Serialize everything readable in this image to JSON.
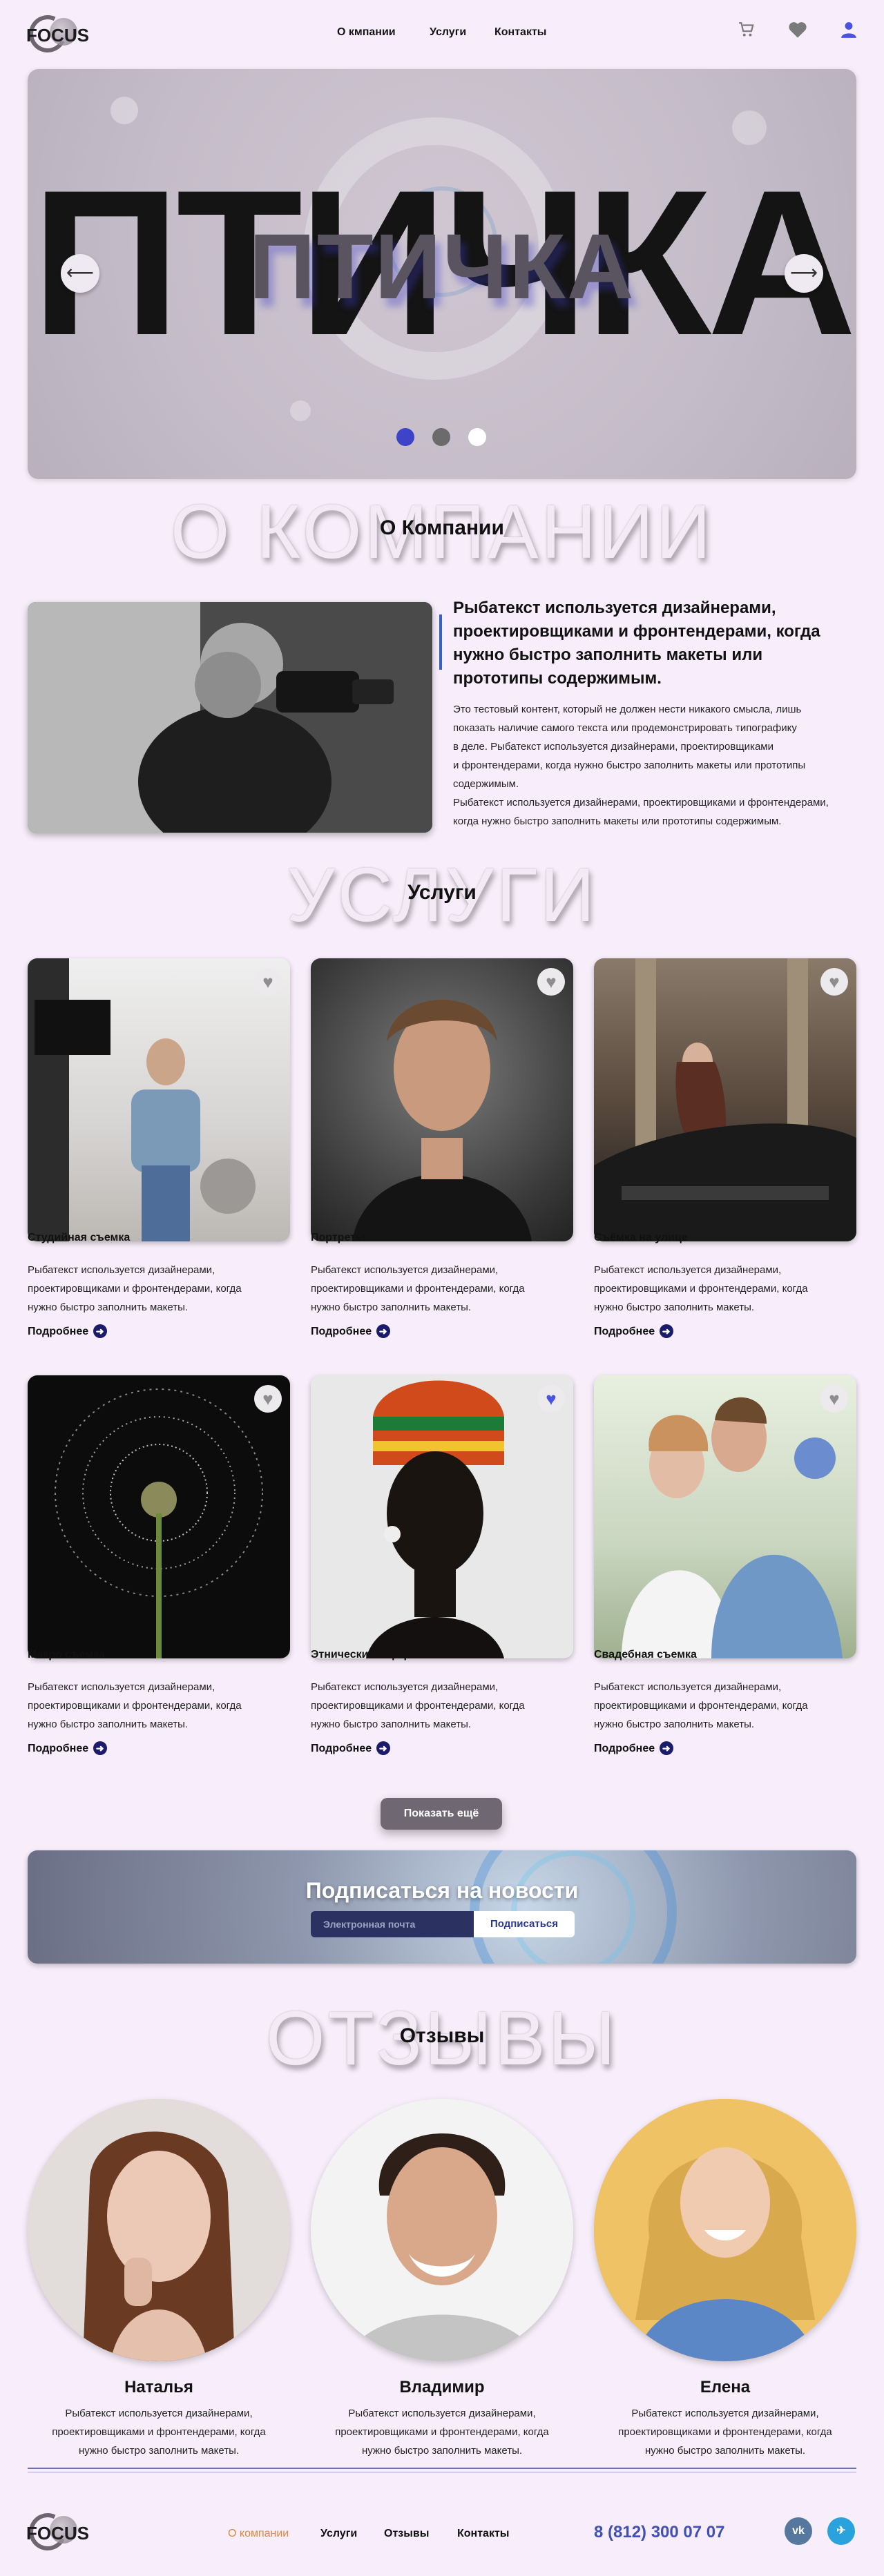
{
  "brand": {
    "name": "FOCUS"
  },
  "header": {
    "nav": [
      "О кмпании",
      "Услуги",
      "Контакты"
    ],
    "icons": [
      "cart-icon",
      "heart-icon",
      "user-icon"
    ],
    "accent": "#4a52e0"
  },
  "hero": {
    "big_text": "ПТИЧКА",
    "small_text": "ПТИЧКА",
    "prev": "⟵",
    "next": "⟶",
    "dots": [
      "#3d44c8",
      "#6b6b6b",
      "#ffffff"
    ]
  },
  "about": {
    "bg_title": "О КОМПАНИИ",
    "title": "О Компании",
    "heading": "Рыбатекст используется дизайнерами, проектировщиками и фронтендерами, когда нужно быстро заполнить макеты или прототипы содержимым.",
    "text": [
      "Это тестовый контент, который не должен нести никакого смысла, лишь",
      "показать наличие самого текста или продемонстрировать типографику",
      "в деле. Рыбатекст используется дизайнерами, проектировщиками",
      "и фронтендерами, когда нужно быстро заполнить макеты или прототипы",
      "содержимым.",
      "Рыбатекст используется дизайнерами, проектировщиками и фронтендерами,",
      "когда нужно быстро заполнить макеты или прототипы содержимым."
    ]
  },
  "services": {
    "bg_title": "УСЛУГИ",
    "title": "Услуги",
    "more_label": "Подробнее",
    "items": [
      {
        "title": "Студийная съемка",
        "desc": [
          "Рыбатекст используется дизайнерами,",
          "проектировщиками и фронтендерами, когда",
          "нужно быстро заполнить макеты."
        ],
        "liked": false
      },
      {
        "title": "Портреты",
        "desc": [
          "Рыбатекст используется дизайнерами,",
          "проектировщиками и фронтендерами, когда",
          "нужно быстро заполнить макеты."
        ],
        "liked": false
      },
      {
        "title": "Съёмка на улице",
        "desc": [
          "Рыбатекст используется дизайнерами,",
          "проектировщиками и фронтендерами, когда",
          "нужно быстро заполнить макеты."
        ],
        "liked": false
      },
      {
        "title": "Макро съемка",
        "desc": [
          "Рыбатекст используется дизайнерами,",
          "проектировщиками и фронтендерами, когда",
          "нужно быстро заполнить макеты."
        ],
        "liked": false
      },
      {
        "title": "Этнический портрет",
        "desc": [
          "Рыбатекст используется дизайнерами,",
          "проектировщиками и фронтендерами, когда",
          "нужно быстро заполнить макеты."
        ],
        "liked": true
      },
      {
        "title": "Свадебная съемка",
        "desc": [
          "Рыбатекст используется дизайнерами,",
          "проектировщиками и фронтендерами, когда",
          "нужно быстро заполнить макеты."
        ],
        "liked": false
      }
    ],
    "show_more": "Показать ещё"
  },
  "subscribe": {
    "title": "Подписаться на новости",
    "placeholder": "Электронная почта",
    "button": "Подписаться"
  },
  "reviews": {
    "bg_title": "ОТЗЫВЫ",
    "title": "Отзывы",
    "items": [
      {
        "name": "Наталья",
        "text": [
          "Рыбатекст используется дизайнерами,",
          "проектировщиками и фронтендерами, когда",
          "нужно быстро заполнить макеты."
        ]
      },
      {
        "name": "Владимир",
        "text": [
          "Рыбатекст используется дизайнерами,",
          "проектировщиками и фронтендерами, когда",
          "нужно быстро заполнить макеты."
        ]
      },
      {
        "name": "Елена",
        "text": [
          "Рыбатекст используется дизайнерами,",
          "проектировщиками и фронтендерами, когда",
          "нужно быстро заполнить макеты."
        ]
      }
    ]
  },
  "footer": {
    "nav": [
      "О компании",
      "Услуги",
      "Отзывы",
      "Контакты"
    ],
    "nav_active_color": "#d98a3a",
    "phone": "8 (812) 300 07 07",
    "social": [
      {
        "icon": "vk-icon",
        "glyph": "vk",
        "color": "#56789e"
      },
      {
        "icon": "telegram-icon",
        "glyph": "✈",
        "color": "#2aa3dc"
      }
    ]
  }
}
